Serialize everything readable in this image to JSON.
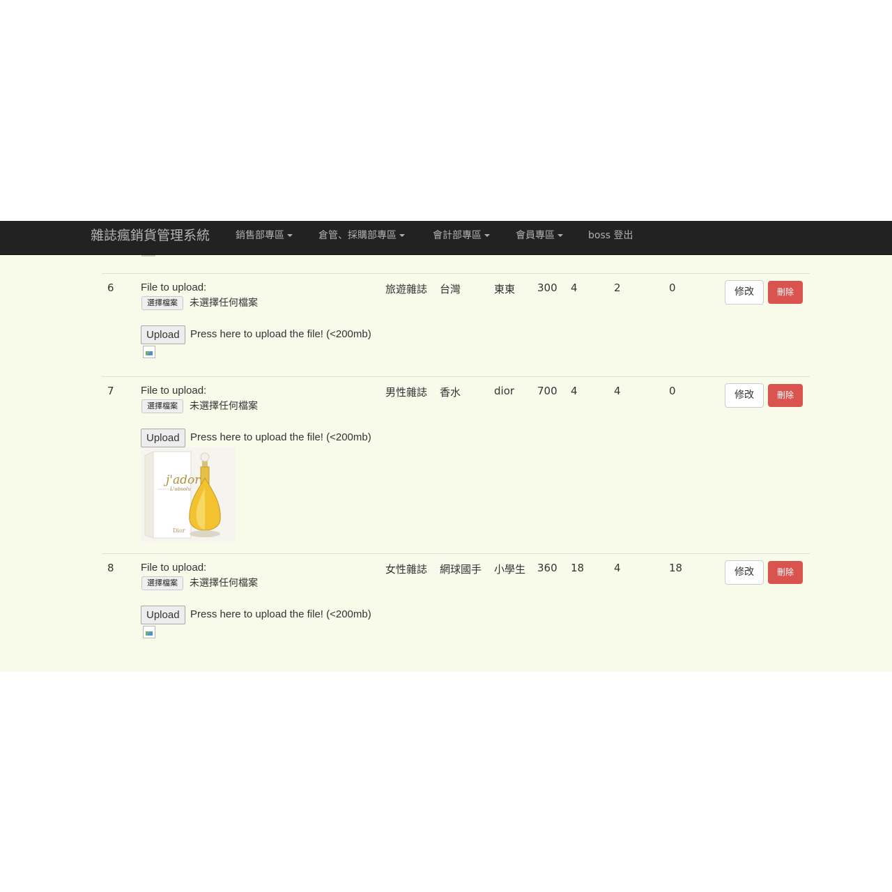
{
  "navbar": {
    "brand": "雜誌瘋銷貨管理系統",
    "items": [
      {
        "label": "銷售部專區",
        "dropdown": true
      },
      {
        "label": "倉管、採購部專區",
        "dropdown": true
      },
      {
        "label": "會計部專區",
        "dropdown": true
      },
      {
        "label": "會員專區",
        "dropdown": true
      },
      {
        "label": "boss 登出",
        "dropdown": false
      }
    ]
  },
  "upload": {
    "file_label": "File to upload:",
    "choose_label": "選擇檔案",
    "no_file_label": "未選擇任何檔案",
    "upload_label": "Upload",
    "hint": "Press here to upload the file! (<200mb)"
  },
  "actions": {
    "edit_label": "修改",
    "delete_label": "刪除"
  },
  "rows": [
    {
      "id": "6",
      "category": "旅遊雜誌",
      "name": "台灣",
      "publisher": "東東",
      "price": "300",
      "c1": "4",
      "c2": "2",
      "c3": "0",
      "image": "broken"
    },
    {
      "id": "7",
      "category": "男性雜誌",
      "name": "香水",
      "publisher": "dior",
      "price": "700",
      "c1": "4",
      "c2": "4",
      "c3": "0",
      "image": "perfume-photo"
    },
    {
      "id": "8",
      "category": "女性雜誌",
      "name": "網球國手",
      "publisher": "小學生",
      "price": "360",
      "c1": "18",
      "c2": "4",
      "c3": "18",
      "image": "broken"
    }
  ],
  "photo_text": {
    "brand_script": "j'adore",
    "sub_script": "L'absolu",
    "maker": "Dior"
  },
  "colors": {
    "navbar_bg": "#222222",
    "content_bg": "#f8fbea",
    "danger": "#d9534f"
  }
}
